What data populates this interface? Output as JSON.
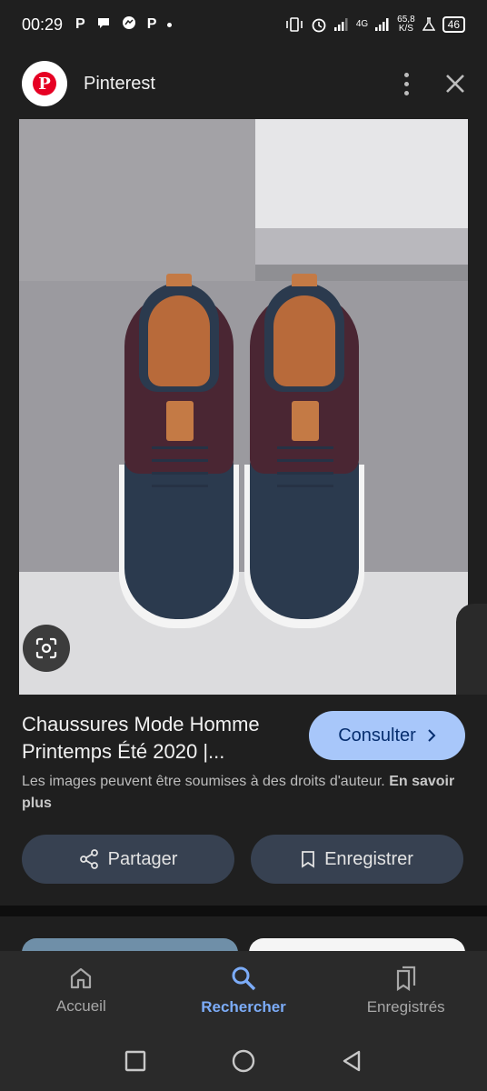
{
  "status_bar": {
    "time": "00:29",
    "network": "4G",
    "speed": "65,8",
    "speed_unit": "K/S",
    "battery": "46"
  },
  "header": {
    "app_name": "Pinterest",
    "logo_letter": "P"
  },
  "image": {
    "icon": "google-lens-icon"
  },
  "pin": {
    "title": "Chaussures Mode Homme Printemps Été 2020 |...",
    "consult_label": "Consulter",
    "copyright_text": "Les images peuvent être soumises à des droits d'auteur.",
    "learn_more": "En savoir plus",
    "share_label": "Partager",
    "save_label": "Enregistrer"
  },
  "bottom_nav": {
    "items": [
      {
        "label": "Accueil",
        "icon": "home-icon",
        "active": false
      },
      {
        "label": "Rechercher",
        "icon": "search-icon",
        "active": true
      },
      {
        "label": "Enregistrés",
        "icon": "bookmarks-icon",
        "active": false
      }
    ]
  },
  "colors": {
    "background": "#1f1f1f",
    "accent": "#a8c7fa",
    "active_nav": "#7cacf8",
    "pinterest_red": "#e60023"
  }
}
